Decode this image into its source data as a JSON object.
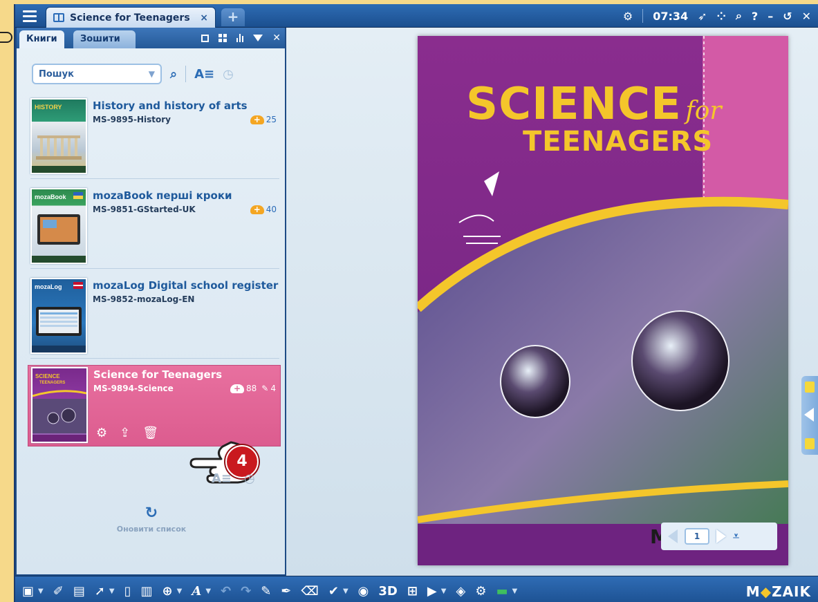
{
  "titlebar": {
    "tab_title": "Science for Teenagers",
    "tab_close": "×",
    "add_tab": "+",
    "clock": "07:34",
    "icons": [
      "settings-icon",
      "rocket-icon",
      "apps-icon",
      "search-icon",
      "help-icon",
      "minimize-icon",
      "restore-icon",
      "close-icon"
    ]
  },
  "panel": {
    "tabs": [
      "Книги",
      "Зошити"
    ],
    "search_placeholder": "Пошук",
    "books": [
      {
        "title": "History and history of arts",
        "code": "MS-9895-History",
        "count": "25"
      },
      {
        "title": "mozaBook перші кроки",
        "code": "MS-9851-GStarted-UK",
        "count": "40"
      },
      {
        "title": "mozaLog Digital school register",
        "code": "MS-9852-mozaLog-EN",
        "count": ""
      },
      {
        "title": "Science for Teenagers",
        "code": "MS-9894-Science",
        "count": "88",
        "notes": "4"
      }
    ],
    "refresh_label": "Оновити список",
    "badge": "4"
  },
  "cover": {
    "line1": "SCIENCE",
    "for": "for",
    "line2": "TEENAGERS",
    "page": "1"
  },
  "toolbar": {
    "logo_left": "M",
    "logo_mid": "◆",
    "logo_right": "ZAIK",
    "three_d": "3D"
  },
  "colors": {
    "accent": "#2b6cb5",
    "active_row": "#e06a98",
    "cover_purple": "#7a2a8c",
    "cover_yellow": "#f4c62b",
    "badge_red": "#c9191f"
  }
}
